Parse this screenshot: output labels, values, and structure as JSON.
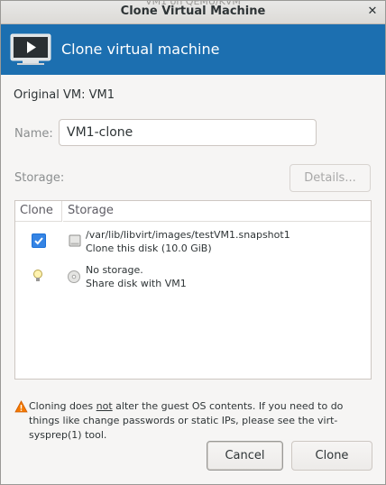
{
  "window": {
    "background_title": "VM1 on QEMU/KVM",
    "title": "Clone Virtual Machine",
    "close_glyph": "✕"
  },
  "banner": {
    "icon": "vm-screen-icon",
    "title": "Clone virtual machine",
    "color": "#1c6fb0"
  },
  "original_vm": {
    "label": "Original VM:",
    "value": "VM1"
  },
  "name_field": {
    "label": "Name:",
    "value": "VM1-clone"
  },
  "storage": {
    "label": "Storage:",
    "details_button": "Details..."
  },
  "table": {
    "headers": [
      "Clone",
      "Storage"
    ],
    "rows": [
      {
        "checked": true,
        "icon": "hard-disk-icon",
        "path": "/var/lib/libvirt/images/testVM1.snapshot1",
        "note": "Clone this disk (10.0 GiB)"
      },
      {
        "checked": false,
        "icon": "cdrom-icon",
        "indicator_icon": "lightbulb-icon",
        "path": "No storage.",
        "note": "Share disk with VM1"
      }
    ]
  },
  "warning": {
    "icon": "warning-icon",
    "before": "Cloning does ",
    "emphasis": "not",
    "after": " alter the guest OS contents. If you need to do things like change passwords or static IPs, please see the virt-sysprep(1) tool."
  },
  "buttons": {
    "cancel": "Cancel",
    "clone": "Clone"
  }
}
